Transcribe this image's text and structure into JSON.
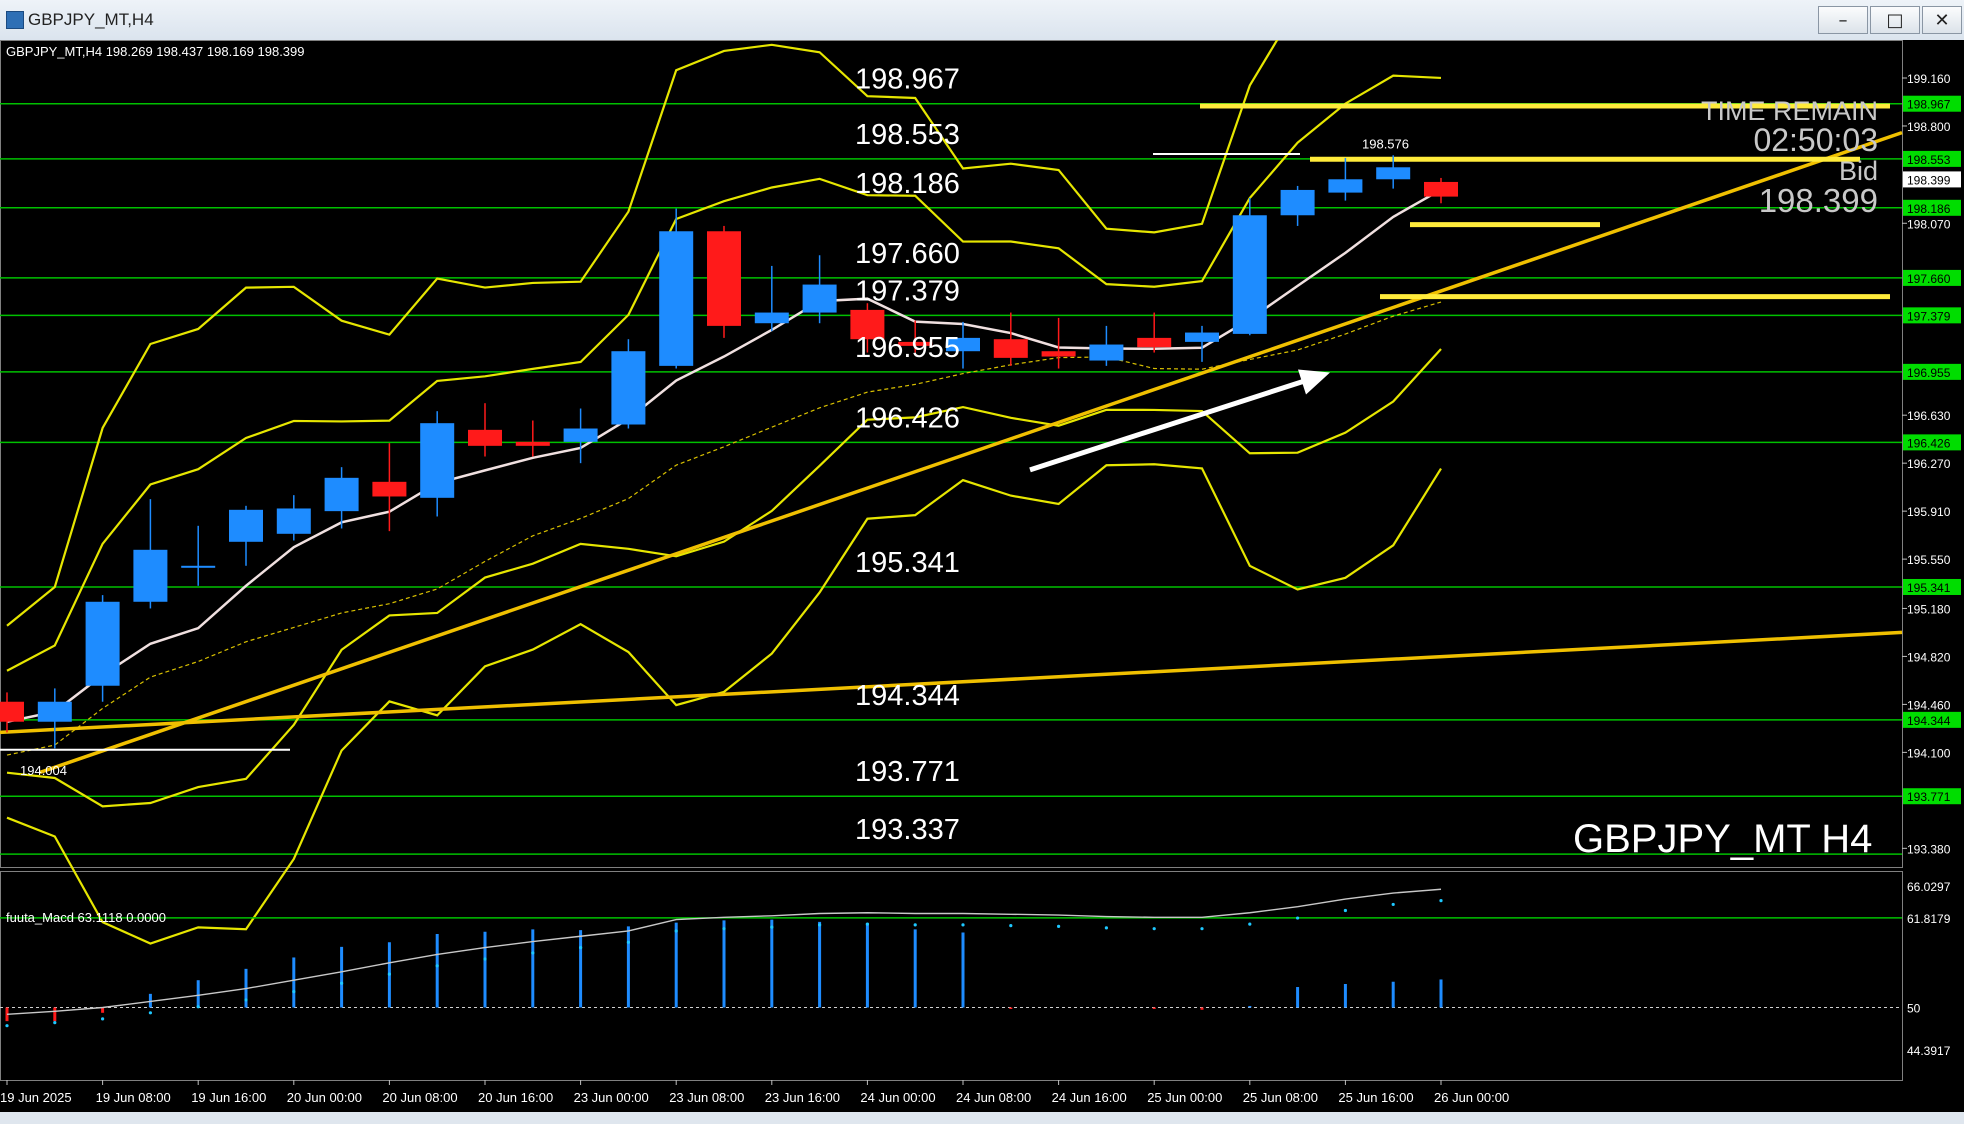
{
  "window": {
    "title": "GBPJPY_MT,H4",
    "buttons": [
      "minimize-icon",
      "restore-icon",
      "close-icon"
    ]
  },
  "chart": {
    "header": "GBPJPY_MT,H4  198.269 198.437 198.169 198.399",
    "watermark": "GBPJPY_MT  H4",
    "timer": {
      "label": "TIME REMAIN",
      "value": "02:50:03",
      "bid_label": "Bid",
      "bid_value": "198.399"
    },
    "high_label": "198.576",
    "low_label": "194.004",
    "level_labels": [
      "198.967",
      "198.553",
      "198.186",
      "197.660",
      "197.379",
      "196.955",
      "196.426",
      "195.341",
      "194.344",
      "193.771",
      "193.337"
    ],
    "price_axis": [
      "199.160",
      "198.800",
      "198.070",
      "196.630",
      "196.270",
      "195.910",
      "195.550",
      "195.180",
      "194.820",
      "194.460",
      "194.100",
      "193.380"
    ],
    "price_tags": [
      "198.967",
      "198.553",
      "198.399",
      "198.186",
      "197.660",
      "197.379",
      "196.955",
      "196.426",
      "195.341",
      "194.344",
      "193.771"
    ],
    "time_axis": [
      "19 Jun 2025",
      "19 Jun 08:00",
      "19 Jun 16:00",
      "20 Jun 00:00",
      "20 Jun 08:00",
      "20 Jun 16:00",
      "23 Jun 00:00",
      "23 Jun 08:00",
      "23 Jun 16:00",
      "24 Jun 00:00",
      "24 Jun 08:00",
      "24 Jun 16:00",
      "25 Jun 00:00",
      "25 Jun 08:00",
      "25 Jun 16:00",
      "26 Jun 00:00"
    ],
    "macd": {
      "header": "fuuta_Macd 63.1118  0.0000",
      "axis": [
        "66.0297",
        "61.8179",
        "50",
        "44.3917"
      ]
    },
    "colors": {
      "bull": "#1e8cff",
      "bear": "#ff1a1a",
      "level": "#00c000",
      "band": "#e6e600",
      "trend": "#f0c000",
      "tag": "#00dd00"
    }
  },
  "chart_data": {
    "type": "candlestick",
    "title": "GBPJPY_MT,H4",
    "ohlc_current": {
      "open": 198.269,
      "high": 198.437,
      "low": 198.169,
      "close": 198.399
    },
    "candles": [
      {
        "o": 194.48,
        "h": 194.55,
        "l": 194.25,
        "c": 194.33
      },
      {
        "o": 194.33,
        "h": 194.58,
        "l": 194.13,
        "c": 194.48
      },
      {
        "o": 194.6,
        "h": 195.28,
        "l": 194.48,
        "c": 195.23
      },
      {
        "o": 195.23,
        "h": 196.0,
        "l": 195.18,
        "c": 195.62
      },
      {
        "o": 195.5,
        "h": 195.8,
        "l": 195.35,
        "c": 195.5
      },
      {
        "o": 195.68,
        "h": 195.95,
        "l": 195.5,
        "c": 195.92
      },
      {
        "o": 195.74,
        "h": 196.03,
        "l": 195.69,
        "c": 195.93
      },
      {
        "o": 195.91,
        "h": 196.24,
        "l": 195.78,
        "c": 196.16
      },
      {
        "o": 196.13,
        "h": 196.42,
        "l": 195.76,
        "c": 196.02
      },
      {
        "o": 196.01,
        "h": 196.66,
        "l": 195.87,
        "c": 196.57
      },
      {
        "o": 196.52,
        "h": 196.72,
        "l": 196.32,
        "c": 196.4
      },
      {
        "o": 196.43,
        "h": 196.59,
        "l": 196.32,
        "c": 196.4
      },
      {
        "o": 196.43,
        "h": 196.68,
        "l": 196.27,
        "c": 196.53
      },
      {
        "o": 196.56,
        "h": 197.2,
        "l": 196.53,
        "c": 197.11
      },
      {
        "o": 197.0,
        "h": 198.18,
        "l": 196.98,
        "c": 198.01
      },
      {
        "o": 198.01,
        "h": 198.05,
        "l": 197.21,
        "c": 197.3
      },
      {
        "o": 197.32,
        "h": 197.75,
        "l": 197.26,
        "c": 197.4
      },
      {
        "o": 197.4,
        "h": 197.83,
        "l": 197.32,
        "c": 197.61
      },
      {
        "o": 197.42,
        "h": 197.47,
        "l": 197.1,
        "c": 197.2
      },
      {
        "o": 197.18,
        "h": 197.34,
        "l": 197.1,
        "c": 197.15
      },
      {
        "o": 197.11,
        "h": 197.33,
        "l": 196.98,
        "c": 197.21
      },
      {
        "o": 197.2,
        "h": 197.4,
        "l": 197.0,
        "c": 197.06
      },
      {
        "o": 197.11,
        "h": 197.36,
        "l": 196.98,
        "c": 197.07
      },
      {
        "o": 197.04,
        "h": 197.3,
        "l": 197.0,
        "c": 197.16
      },
      {
        "o": 197.21,
        "h": 197.4,
        "l": 197.1,
        "c": 197.14
      },
      {
        "o": 197.18,
        "h": 197.3,
        "l": 197.03,
        "c": 197.25
      },
      {
        "o": 197.24,
        "h": 198.26,
        "l": 197.23,
        "c": 198.13
      },
      {
        "o": 198.13,
        "h": 198.35,
        "l": 198.05,
        "c": 198.32
      },
      {
        "o": 198.3,
        "h": 198.56,
        "l": 198.24,
        "c": 198.4
      },
      {
        "o": 198.4,
        "h": 198.58,
        "l": 198.33,
        "c": 198.49
      },
      {
        "o": 198.38,
        "h": 198.41,
        "l": 198.22,
        "c": 198.27
      }
    ],
    "horizontal_levels": [
      198.967,
      198.553,
      198.186,
      197.66,
      197.379,
      196.955,
      196.426,
      195.341,
      194.344,
      193.771,
      193.337
    ],
    "ylim": [
      193.3,
      199.3
    ],
    "macd": {
      "ylim": [
        44.3917,
        66.0297
      ],
      "signal": [
        49.1,
        49.5,
        50.0,
        50.8,
        51.6,
        52.5,
        53.6,
        54.7,
        55.9,
        57.0,
        57.9,
        58.7,
        59.4,
        60.1,
        61.6,
        61.9,
        62.1,
        62.4,
        62.5,
        62.4,
        62.4,
        62.3,
        62.2,
        62.0,
        61.9,
        61.9,
        62.5,
        63.3,
        64.3,
        65.1,
        65.6
      ],
      "histogram": [
        48.2,
        48.2,
        49.3,
        51.8,
        53.6,
        55.1,
        56.6,
        58.0,
        58.6,
        59.7,
        60.0,
        60.3,
        60.2,
        60.7,
        61.2,
        61.5,
        61.6,
        61.3,
        61.1,
        60.3,
        59.9,
        49.8,
        50.0,
        50.0,
        49.8,
        49.7,
        50.2,
        52.7,
        53.1,
        53.4,
        53.7
      ]
    }
  }
}
